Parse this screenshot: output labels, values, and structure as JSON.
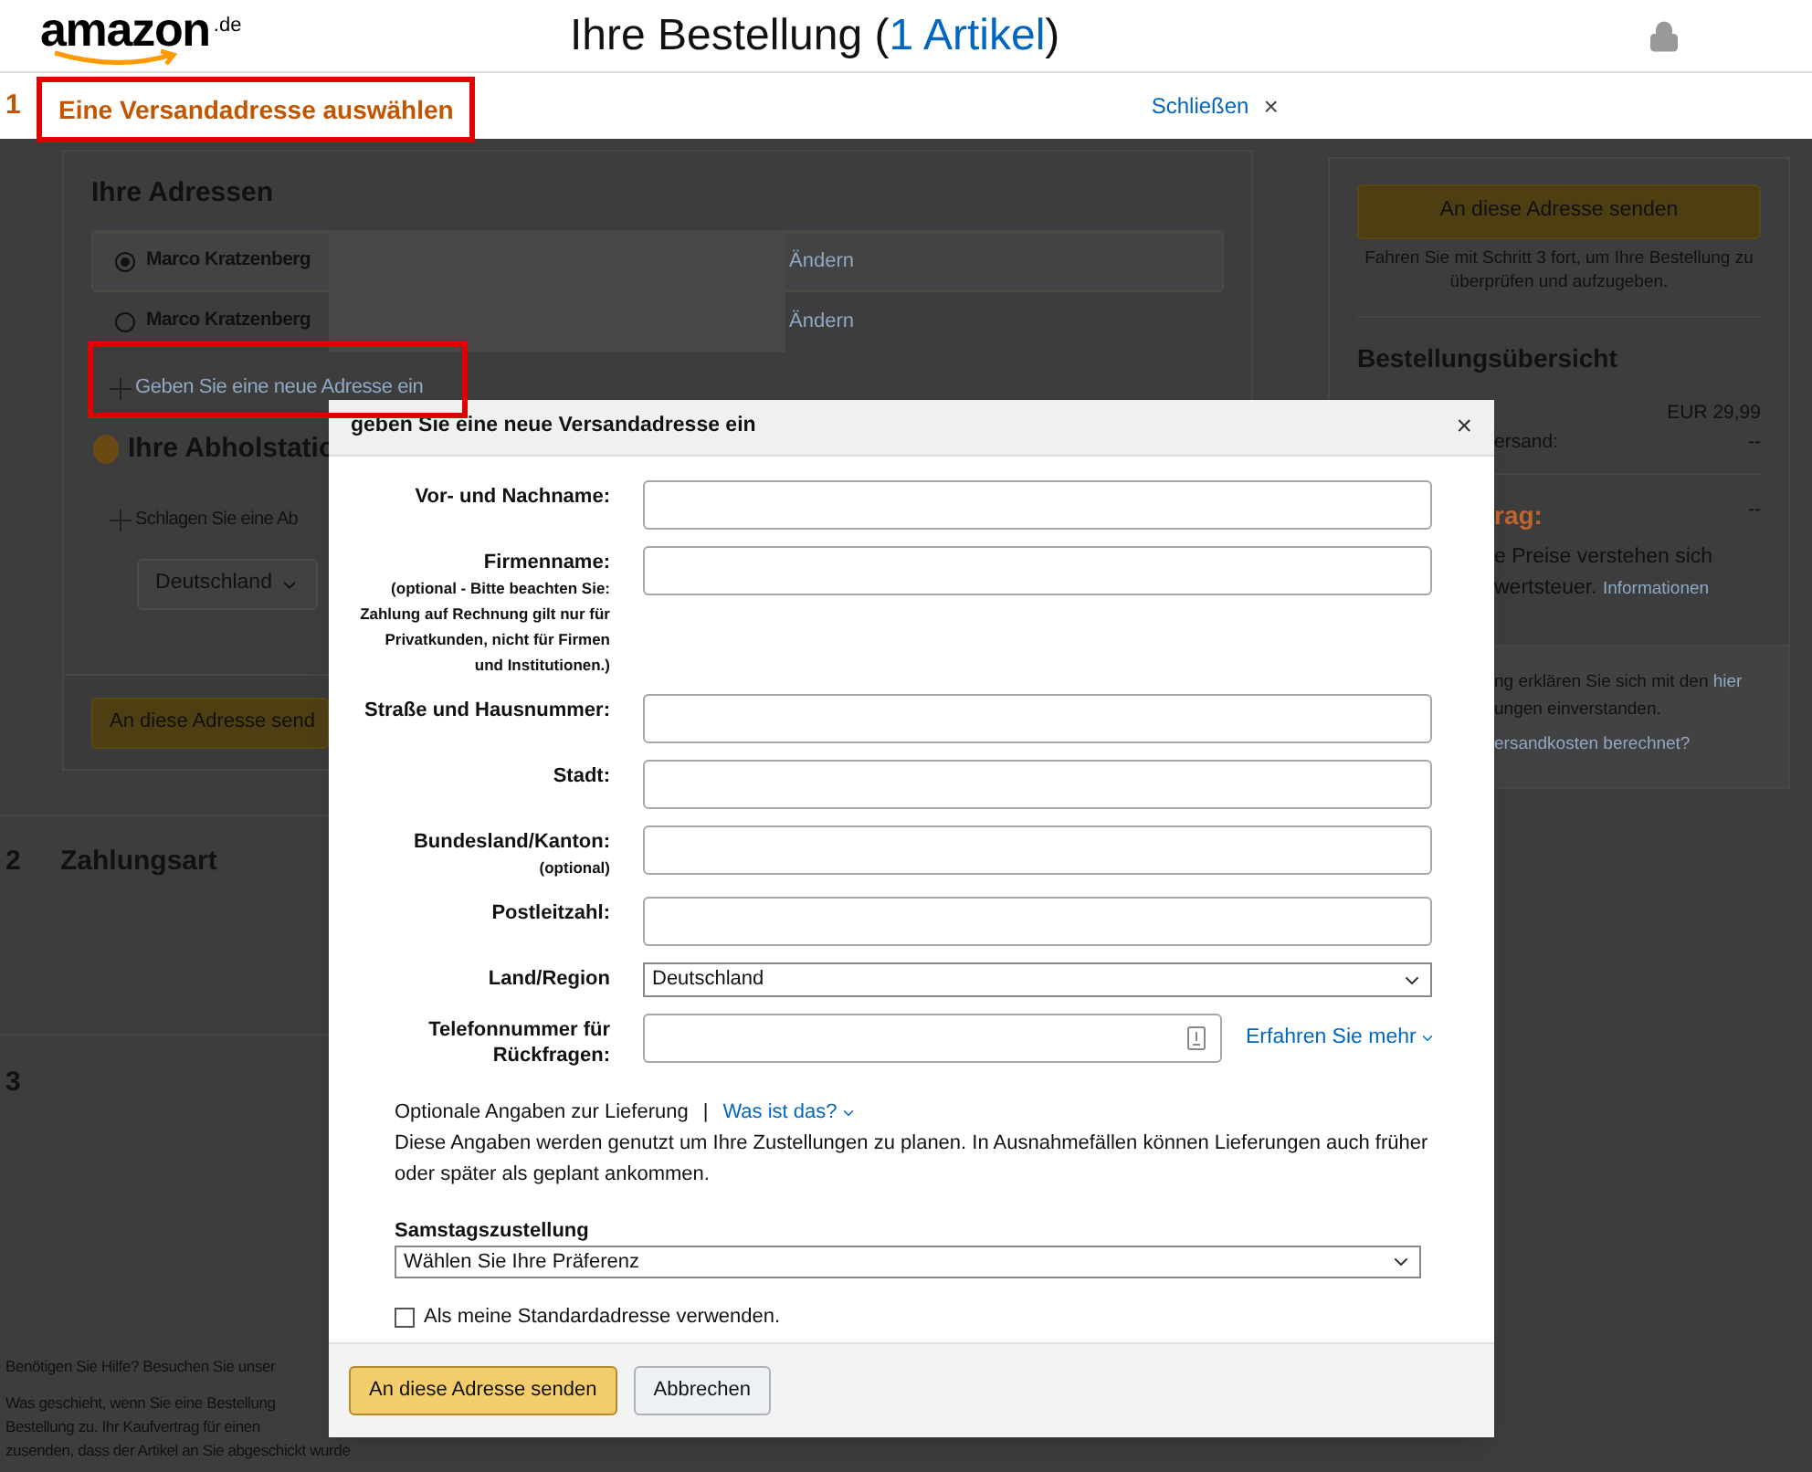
{
  "header": {
    "logo": "amazon",
    "logo_suffix": ".de",
    "title": "Ihre Bestellung",
    "paren_open": "(",
    "item_link": "1 Artikel",
    "paren_close": ")"
  },
  "steps": [
    {
      "number": "1",
      "title": "Eine Versandadresse auswählen",
      "active": true
    },
    {
      "number": "2",
      "title": "Zahlungsart",
      "active": false
    },
    {
      "number": "3",
      "active": false
    }
  ],
  "close_link": "Schließen",
  "close_icon": "×",
  "addresses": {
    "heading": "Ihre Adressen",
    "items": [
      {
        "name": "Marco Kratzenberg",
        "action": "Ändern",
        "selected": true
      },
      {
        "name": "Marco Kratzenberg",
        "action": "Ändern",
        "selected": false
      }
    ],
    "new_link": "Geben Sie eine neue Adresse ein"
  },
  "pickup": {
    "heading": "Ihre Abholstatio",
    "suggest": "Schlagen Sie eine Ab",
    "country": "Deutschland"
  },
  "left_button": "An diese Adresse send",
  "sidebar": {
    "button": "An diese Adresse senden",
    "hint": "Fahren Sie mit Schritt 3 fort, um Ihre Bestellung zu überprüfen und aufzugeben.",
    "heading": "Bestellungsübersicht",
    "price": "EUR 29,99",
    "shipping_label": "ersand:",
    "shipping_value": "--",
    "total_label": "rag:",
    "total_value": "--",
    "vat_line1": "e Preise verstehen sich",
    "vat_line2": "wertsteuer.",
    "vat_link": "Informationen",
    "terms_line1": "ng erklären Sie sich mit den",
    "terms_link": "hier",
    "terms_line2": "ungen einverstanden.",
    "shipping_link": "ersandkosten berechnet?"
  },
  "footer": {
    "help": "Benötigen Sie Hilfe? Besuchen Sie unser",
    "lines": [
      "Was geschieht, wenn Sie eine Bestellung",
      "Bestellung zu. Ihr Kaufvertrag für einen",
      "zusenden, dass der Artikel an Sie abgeschickt wurde"
    ]
  },
  "dialog": {
    "title": "geben Sie eine neue Versandadresse ein",
    "close_icon": "×",
    "fields": [
      {
        "kind": "text",
        "label": "Vor- und Nachname:"
      },
      {
        "kind": "text",
        "label": "Firmenname:",
        "note": "(optional - Bitte beachten Sie: Zahlung auf Rechnung gilt nur für Privatkunden, nicht für Firmen und Institutionen.)"
      },
      {
        "kind": "text",
        "label": "Straße und Hausnummer:"
      },
      {
        "kind": "text",
        "label": "Stadt:"
      },
      {
        "kind": "text",
        "label": "Bundesland/Kanton:",
        "note": "(optional)"
      },
      {
        "kind": "text",
        "label": "Postleitzahl:"
      },
      {
        "kind": "select",
        "label": "Land/Region",
        "value": "Deutschland"
      },
      {
        "kind": "phone",
        "label": "Telefonnummer für Rückfragen:",
        "link": "Erfahren Sie mehr"
      }
    ],
    "optional_label": "Optionale Angaben zur Lieferung",
    "separator": "|",
    "info_link": "Was ist das?",
    "info_text": "Diese Angaben werden genutzt um Ihre Zustellungen zu planen. In Ausnahmefällen können Lieferungen auch früher oder später als geplant ankommen.",
    "saturday_label": "Samstagszustellung",
    "saturday_value": "Wählen Sie Ihre Präferenz",
    "default_checkbox": {
      "label": "Als meine Standardadresse verwenden.",
      "checked": false
    },
    "submit": "An diese Adresse senden",
    "cancel": "Abbrechen"
  }
}
